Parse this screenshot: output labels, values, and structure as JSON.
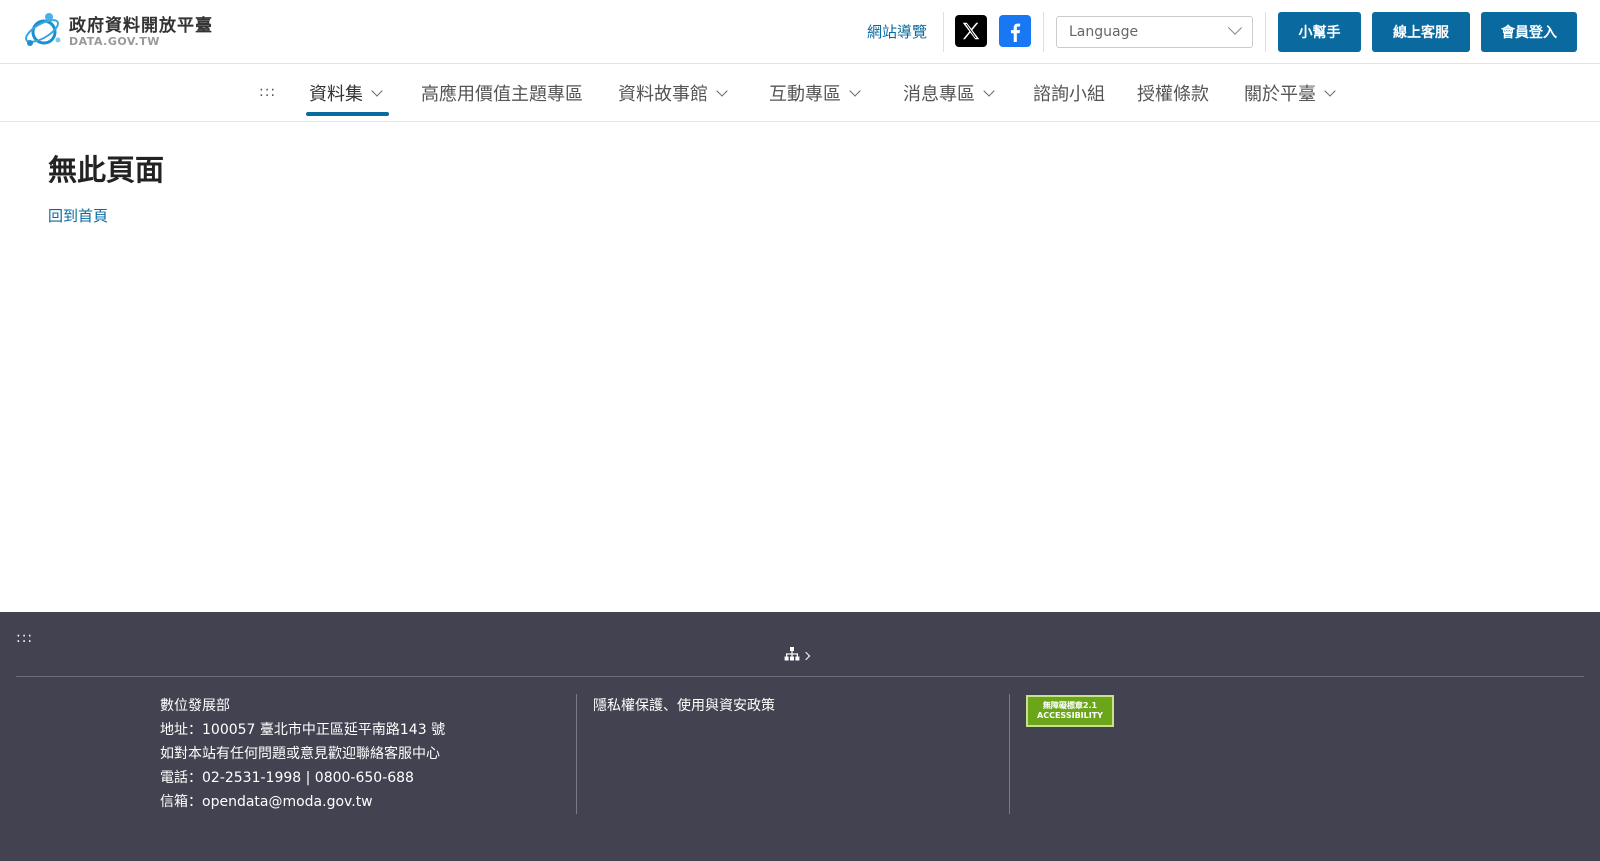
{
  "header": {
    "logo_title": "政府資料開放平臺",
    "logo_subtitle": "DATA.GOV.TW",
    "sitemap_label": "網站導覽",
    "language_placeholder": "Language",
    "buttons": {
      "helper": "小幫手",
      "online_service": "線上客服",
      "member_login": "會員登入"
    }
  },
  "nav": {
    "access_key": ":::",
    "items": [
      {
        "label": "資料集",
        "has_dropdown": true,
        "active": true
      },
      {
        "label": "高應用價值主題專區",
        "has_dropdown": false
      },
      {
        "label": "資料故事館",
        "has_dropdown": true
      },
      {
        "label": "互動專區",
        "has_dropdown": true
      },
      {
        "label": "消息專區",
        "has_dropdown": true
      },
      {
        "label": "諮詢小組",
        "has_dropdown": false
      },
      {
        "label": "授權條款",
        "has_dropdown": false
      },
      {
        "label": "關於平臺",
        "has_dropdown": true
      }
    ]
  },
  "main": {
    "title": "無此頁面",
    "home_link": "回到首頁"
  },
  "footer": {
    "access_key": ":::",
    "org_name": "數位發展部",
    "address": "地址：100057 臺北市中正區延平南路143 號",
    "contact_note": "如對本站有任何問題或意見歡迎聯絡客服中心",
    "phone": "電話：02-2531-1998 | 0800-650-688",
    "email": "信箱：opendata@moda.gov.tw",
    "privacy_link": "隱私權保護、使用與資安政策",
    "accessibility_badge_line1": "無障礙標章2.1",
    "accessibility_badge_line2": "ACCESSIBILITY"
  },
  "colors": {
    "primary": "#0a6aa0",
    "footer_bg": "#424250",
    "badge_green": "#6ba61a"
  }
}
